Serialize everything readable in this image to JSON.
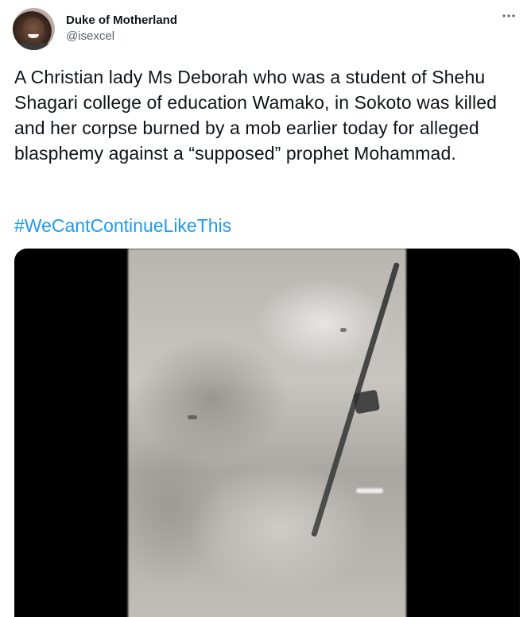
{
  "author": {
    "display_name": "Duke of Motherland",
    "handle": "@isexcel",
    "avatar_icon": "user-avatar"
  },
  "more_icon": "more-options-icon",
  "tweet": {
    "text": "A Christian lady Ms Deborah who was a student of Shehu Shagari college of education Wamako, in Sokoto was killed and her corpse burned by a mob earlier today for alleged blasphemy against a “supposed” prophet Mohammad.",
    "hashtag": "#WeCantContinueLikeThis"
  },
  "colors": {
    "text": "#0f1419",
    "secondary": "#536471",
    "link": "#1d9bf0",
    "media_background": "#000000"
  }
}
